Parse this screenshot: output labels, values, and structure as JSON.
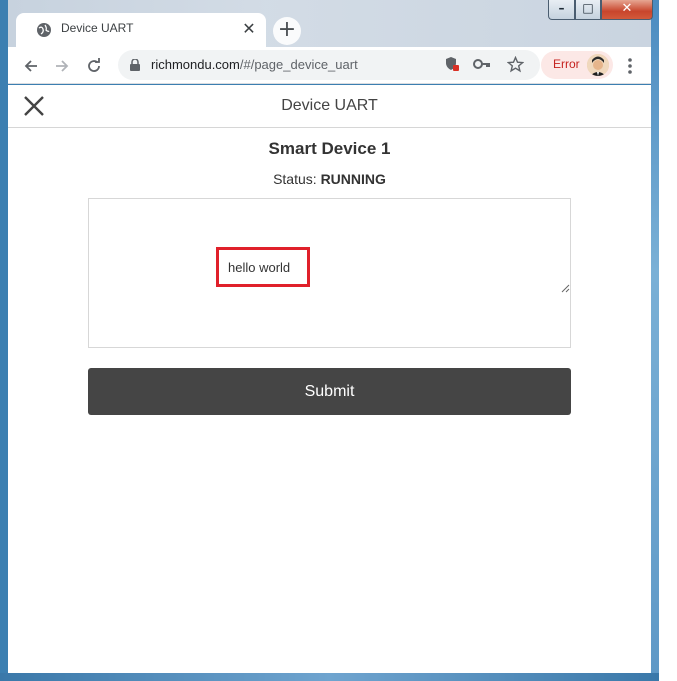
{
  "browser": {
    "tab_title": "Device UART",
    "tab_close_glyph": "✕",
    "new_tab_glyph": "+",
    "url_host": "richmondu.com",
    "url_path": "/#/page_device_uart",
    "error_label": "Error",
    "window_controls": {
      "minimize": "–",
      "maximize": "□",
      "close": "✕"
    },
    "icons": [
      "globe-icon",
      "back-arrow-icon",
      "forward-arrow-icon",
      "reload-icon",
      "lock-icon",
      "shield-blocked-icon",
      "key-icon",
      "star-icon",
      "avatar",
      "more-menu-icon"
    ]
  },
  "app": {
    "title": "Device UART",
    "device_name": "Smart Device 1",
    "status_label": "Status:",
    "status_value": "RUNNING",
    "uart_text": "hello world",
    "submit_label": "Submit"
  },
  "colors": {
    "button_bg": "#454545",
    "highlight": "#e0202a",
    "error_pill": "#fce8e6",
    "error_text": "#c5221f"
  }
}
